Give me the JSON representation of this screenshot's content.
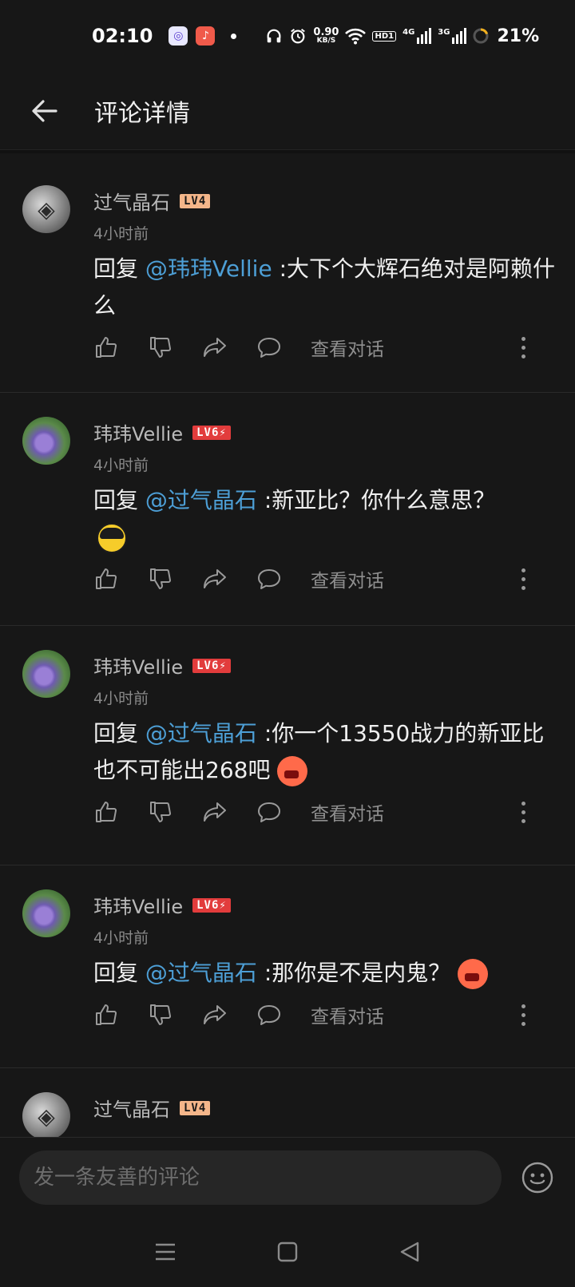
{
  "status_bar": {
    "time": "02:10",
    "net_speed_value": "0.90",
    "net_speed_unit": "KB/S",
    "hd_label": "HD1",
    "sig1_label": "4G",
    "sig2_label": "3G",
    "battery": "21%"
  },
  "header": {
    "title": "评论详情"
  },
  "comments": [
    {
      "username": "过气晶石",
      "level": "LV4",
      "time": "4小时前",
      "reply_prefix": "回复 ",
      "mention": "@玮玮Vellie",
      "text": " :大下个大辉石绝对是阿赖什么",
      "view_label": "查看对话"
    },
    {
      "username": "玮玮Vellie",
      "level": "LV6⚡",
      "time": "4小时前",
      "reply_prefix": "回复 ",
      "mention": "@过气晶石",
      "text": " :新亚比？你什么意思？",
      "view_label": "查看对话"
    },
    {
      "username": "玮玮Vellie",
      "level": "LV6⚡",
      "time": "4小时前",
      "reply_prefix": "回复 ",
      "mention": "@过气晶石",
      "text": " :你一个13550战力的新亚比也不可能出268吧",
      "view_label": "查看对话"
    },
    {
      "username": "玮玮Vellie",
      "level": "LV6⚡",
      "time": "4小时前",
      "reply_prefix": "回复 ",
      "mention": "@过气晶石",
      "text": " :那你是不是内鬼？",
      "view_label": "查看对话"
    },
    {
      "username": "过气晶石",
      "level": "LV4"
    }
  ],
  "composer": {
    "placeholder": "发一条友善的评论"
  },
  "colors": {
    "background": "#171717",
    "mention": "#4d9fd6",
    "lv4_badge": "#f4b68a",
    "lv6_badge": "#e23c3c"
  },
  "icons": [
    "back-arrow-icon",
    "thumbs-up-icon",
    "thumbs-down-icon",
    "share-icon",
    "comment-bubble-icon",
    "more-vertical-icon",
    "emoji-face-icon",
    "menu-icon",
    "home-square-icon",
    "back-triangle-icon"
  ]
}
